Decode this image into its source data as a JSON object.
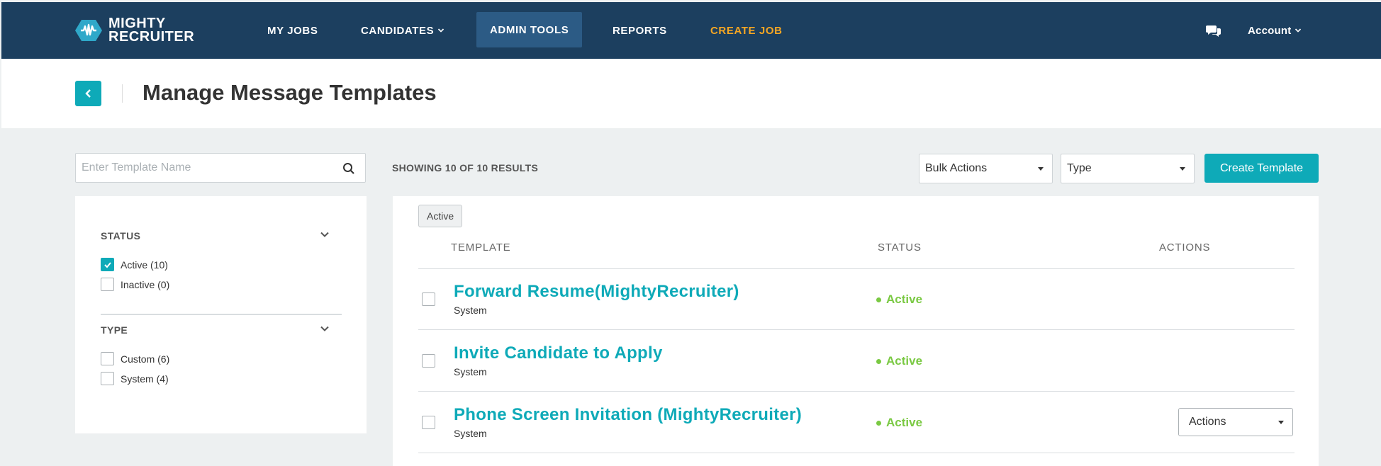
{
  "nav": {
    "logo_line1": "MIGHTY",
    "logo_line2": "RECRUITER",
    "items": [
      {
        "label": "MY JOBS"
      },
      {
        "label": "CANDIDATES"
      },
      {
        "label": "ADMIN TOOLS"
      },
      {
        "label": "REPORTS"
      },
      {
        "label": "CREATE JOB"
      }
    ],
    "account_label": "Account",
    "active_color": "#2c5b85",
    "accent_color": "#f5a623"
  },
  "header": {
    "title": "Manage Message Templates"
  },
  "search": {
    "placeholder": "Enter Template Name",
    "value": ""
  },
  "filters": {
    "status": {
      "title": "STATUS",
      "options": [
        {
          "label": "Active",
          "count": "(10)",
          "checked": true
        },
        {
          "label": "Inactive",
          "count": "(0)",
          "checked": false
        }
      ]
    },
    "type": {
      "title": "TYPE",
      "options": [
        {
          "label": "Custom",
          "count": "(6)",
          "checked": false
        },
        {
          "label": "System",
          "count": "(4)",
          "checked": false
        }
      ]
    }
  },
  "toolbar": {
    "results": "SHOWING 10 OF 10 RESULTS",
    "bulk_actions": "Bulk Actions",
    "type_select": "Type",
    "create_label": "Create Template"
  },
  "table": {
    "active_tag": "Active",
    "columns": {
      "template": "TEMPLATE",
      "status": "STATUS",
      "actions": "ACTIONS"
    },
    "rows": [
      {
        "title": "Forward Resume(MightyRecruiter)",
        "subtitle": "System",
        "status": "Active"
      },
      {
        "title": "Invite Candidate to Apply",
        "subtitle": "System",
        "status": "Active"
      },
      {
        "title": "Phone Screen Invitation (MightyRecruiter)",
        "subtitle": "System",
        "status": "Active",
        "actions": "Actions"
      }
    ],
    "accent_color": "#0eaab8",
    "status_color": "#7ac943"
  }
}
